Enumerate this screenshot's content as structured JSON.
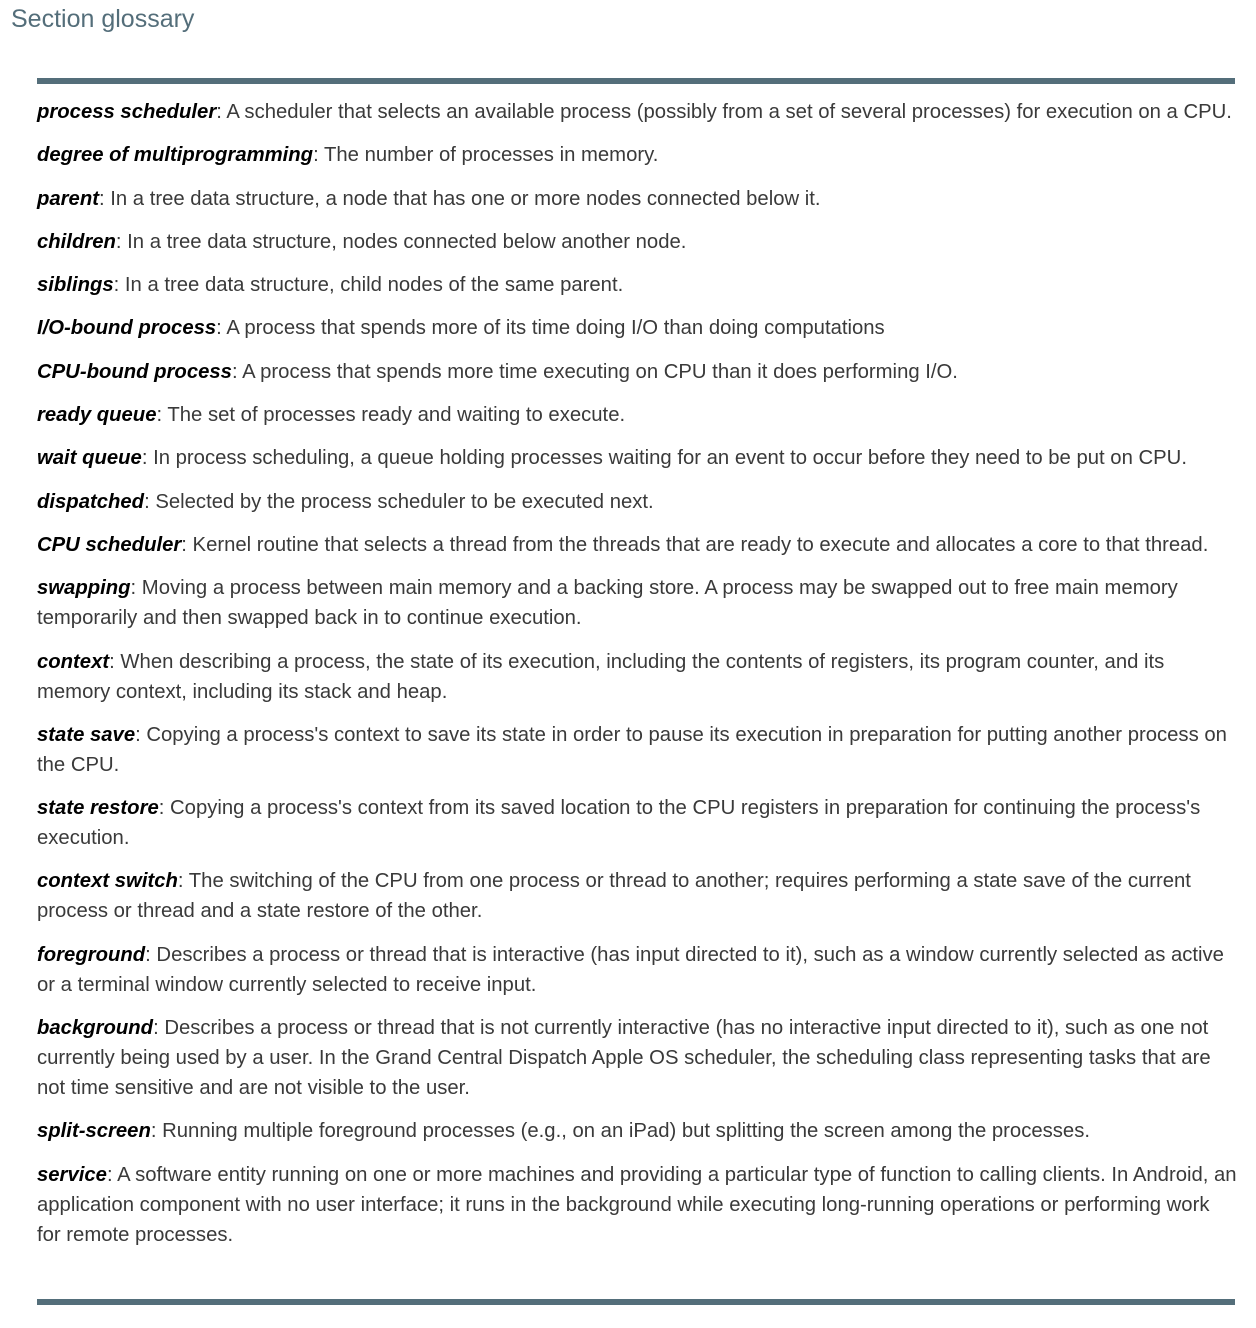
{
  "header": {
    "title": "Section glossary"
  },
  "glossary": [
    {
      "term": "process scheduler",
      "definition": ": A scheduler that selects an available process (possibly from a set of several processes) for execution on a CPU."
    },
    {
      "term": "degree of multiprogramming",
      "definition": ": The number of processes in memory."
    },
    {
      "term": "parent",
      "definition": ": In a tree data structure, a node that has one or more nodes connected below it."
    },
    {
      "term": "children",
      "definition": ": In a tree data structure, nodes connected below another node."
    },
    {
      "term": "siblings",
      "definition": ": In a tree data structure, child nodes of the same parent."
    },
    {
      "term": "I/O-bound process",
      "definition": ": A process that spends more of its time doing I/O than doing computations"
    },
    {
      "term": "CPU-bound process",
      "definition": ": A process that spends more time executing on CPU than it does performing I/O."
    },
    {
      "term": "ready queue",
      "definition": ": The set of processes ready and waiting to execute."
    },
    {
      "term": "wait queue",
      "definition": ": In process scheduling, a queue holding processes waiting for an event to occur before they need to be put on CPU."
    },
    {
      "term": "dispatched",
      "definition": ": Selected by the process scheduler to be executed next."
    },
    {
      "term": "CPU scheduler",
      "definition": ": Kernel routine that selects a thread from the threads that are ready to execute and allocates a core to that thread."
    },
    {
      "term": "swapping",
      "definition": ": Moving a process between main memory and a backing store. A process may be swapped out to free main memory temporarily and then swapped back in to continue execution."
    },
    {
      "term": "context",
      "definition": ": When describing a process, the state of its execution, including the contents of registers, its program counter, and its memory context, including its stack and heap."
    },
    {
      "term": "state save",
      "definition": ": Copying a process's context to save its state in order to pause its execution in preparation for putting another process on the CPU."
    },
    {
      "term": "state restore",
      "definition": ": Copying a process's context from its saved location to the CPU registers in preparation for continuing the process's execution."
    },
    {
      "term": "context switch",
      "definition": ": The switching of the CPU from one process or thread to another; requires performing a state save of the current process or thread and a state restore of the other."
    },
    {
      "term": "foreground",
      "definition": ": Describes a process or thread that is interactive (has input directed to it), such as a window currently selected as active or a terminal window currently selected to receive input."
    },
    {
      "term": "background",
      "definition": ": Describes a process or thread that is not currently interactive (has no interactive input directed to it), such as one not currently being used by a user. In the Grand Central Dispatch Apple OS scheduler, the scheduling class representing tasks that are not time sensitive and are not visible to the user."
    },
    {
      "term": "split-screen",
      "definition": ": Running multiple foreground processes (e.g., on an iPad) but splitting the screen among the processes."
    },
    {
      "term": "service",
      "definition": ": A software entity running on one or more machines and providing a particular type of function to calling clients. In Android, an application component with no user interface; it runs in the background while executing long-running operations or performing work for remote processes."
    }
  ]
}
